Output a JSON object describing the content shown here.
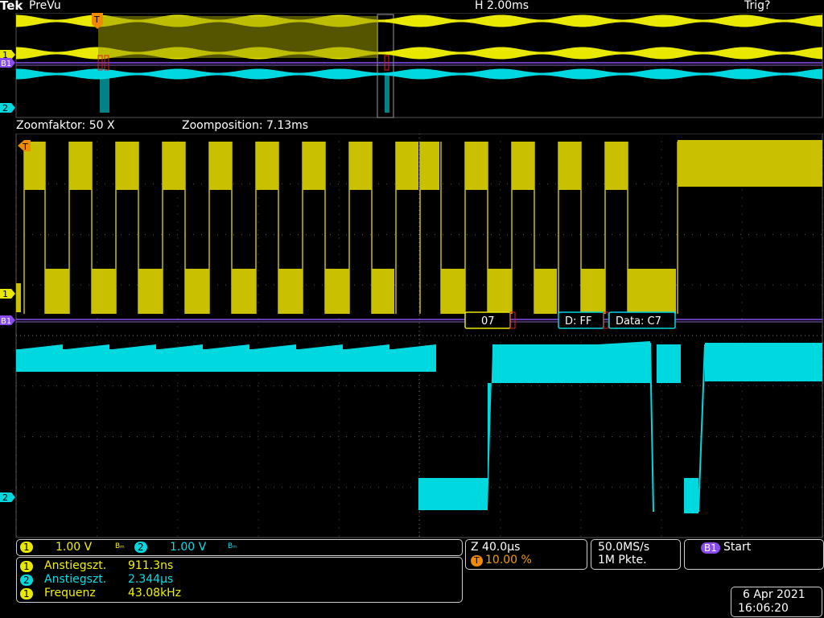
{
  "top": {
    "brand": "Tek",
    "mode": "PreVu",
    "horizontal": "H 2.00ms",
    "trigger_status": "Trig?"
  },
  "zoom": {
    "factor": "Zoomfaktor: 50 X",
    "position": "Zoomposition: 7.13ms"
  },
  "markers": {
    "ch1": "1",
    "ch2": "2",
    "bus": "B1",
    "trigger": "T"
  },
  "decode": {
    "byte1": "07",
    "byte2_label": "D: FF",
    "byte3_label": "Data: C7"
  },
  "channels": {
    "ch1": {
      "num": "1",
      "scale": "1.00 V",
      "bw": "Bₘ"
    },
    "ch2": {
      "num": "2",
      "scale": "1.00 V",
      "bw": "Bₘ"
    }
  },
  "timebase": {
    "zoom": "Z 40.0µs",
    "trig_pos_icon": "T",
    "trig_pos": "10.00 %",
    "sample_rate": "50.0MS/s",
    "record_len": "1M Pkte."
  },
  "trigger_box": {
    "bus": "B1",
    "condition": "Start"
  },
  "measurements": [
    {
      "ch": "1",
      "name": "Anstiegszt.",
      "value": "911.3ns"
    },
    {
      "ch": "2",
      "name": "Anstiegszt.",
      "value": "2.344µs"
    },
    {
      "ch": "1",
      "name": "Frequenz",
      "value": "43.08kHz"
    }
  ],
  "datetime": {
    "date": "6 Apr  2021",
    "time": "16:06:20"
  },
  "colors": {
    "ch1": "#e8e800",
    "ch2": "#00d8e0",
    "bus": "#8a4cf0",
    "trigger": "#f08a00"
  }
}
